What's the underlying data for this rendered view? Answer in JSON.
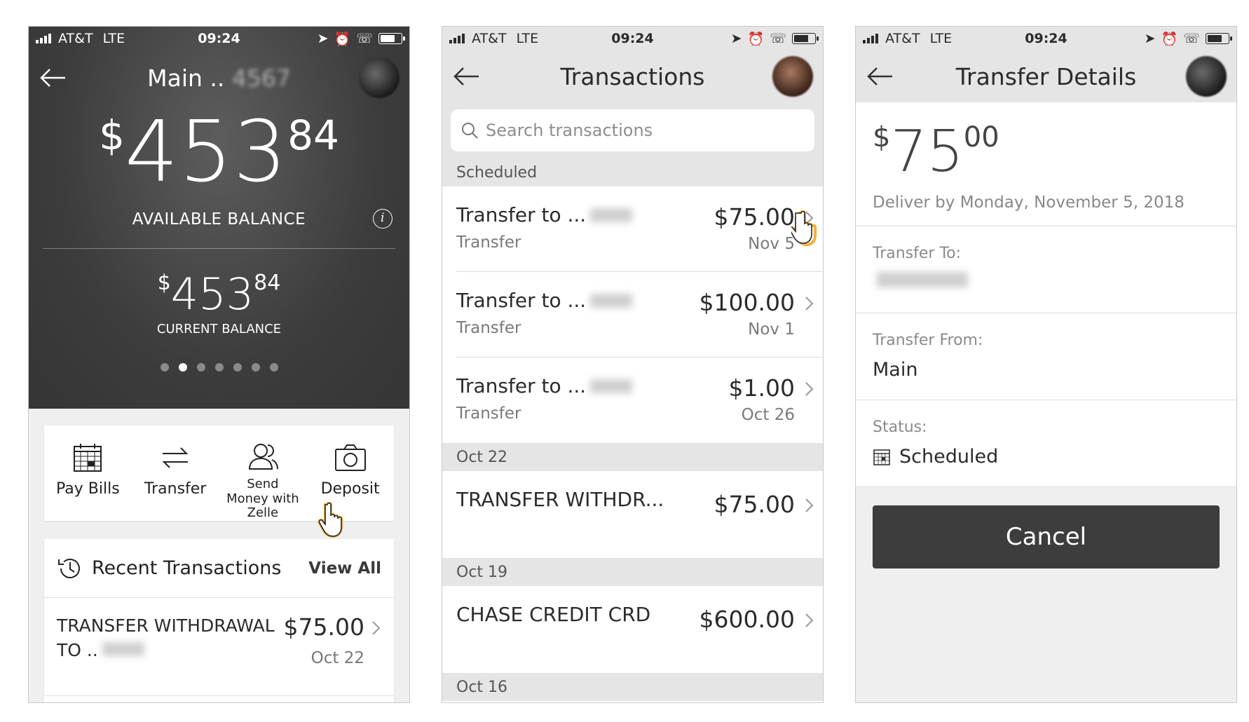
{
  "status_bar": {
    "carrier": "AT&T",
    "network": "LTE",
    "time": "09:24"
  },
  "screen1": {
    "title": "Main ..",
    "available_balance": {
      "currency": "$",
      "dollars": "453",
      "cents": "84",
      "label": "AVAILABLE BALANCE"
    },
    "current_balance": {
      "currency": "$",
      "dollars": "453",
      "cents": "84",
      "label": "CURRENT BALANCE"
    },
    "page_dots": {
      "count": 7,
      "active_index": 1
    },
    "actions": [
      {
        "label": "Pay Bills",
        "icon": "calendar-icon"
      },
      {
        "label": "Transfer",
        "icon": "transfer-arrows-icon"
      },
      {
        "label": "Send Money with Zelle",
        "icon": "people-icon"
      },
      {
        "label": "Deposit",
        "icon": "camera-icon"
      }
    ],
    "recent": {
      "title": "Recent Transactions",
      "view_all": "View All",
      "item": {
        "description": "TRANSFER WITHDRAWAL TO ..",
        "amount": "$75.00",
        "date": "Oct 22"
      }
    }
  },
  "screen2": {
    "title": "Transactions",
    "search_placeholder": "Search transactions",
    "sections": [
      {
        "header": "Scheduled",
        "rows": [
          {
            "name": "Transfer to ...",
            "type": "Transfer",
            "amount": "$75.00",
            "date": "Nov 5"
          },
          {
            "name": "Transfer to ...",
            "type": "Transfer",
            "amount": "$100.00",
            "date": "Nov 1"
          },
          {
            "name": "Transfer to ...",
            "type": "Transfer",
            "amount": "$1.00",
            "date": "Oct 26"
          }
        ]
      },
      {
        "header": "Oct 22",
        "rows": [
          {
            "name": "TRANSFER WITHDR...",
            "amount": "$75.00"
          }
        ]
      },
      {
        "header": "Oct 19",
        "rows": [
          {
            "name": "CHASE CREDIT CRD",
            "amount": "$600.00"
          }
        ]
      },
      {
        "header": "Oct 16",
        "rows": []
      }
    ]
  },
  "screen3": {
    "title": "Transfer Details",
    "amount": {
      "currency": "$",
      "dollars": "75",
      "cents": "00"
    },
    "deliver_by": "Deliver by Monday, November 5, 2018",
    "transfer_to_label": "Transfer To:",
    "transfer_from_label": "Transfer From:",
    "transfer_from_value": "Main",
    "status_label": "Status:",
    "status_value": "Scheduled",
    "cancel_label": "Cancel"
  },
  "colors": {
    "dark_header": "#3f3f3f",
    "light_header": "#e5e5e5",
    "button": "#3d3d3d",
    "cursor_glow": "#f5a623"
  }
}
